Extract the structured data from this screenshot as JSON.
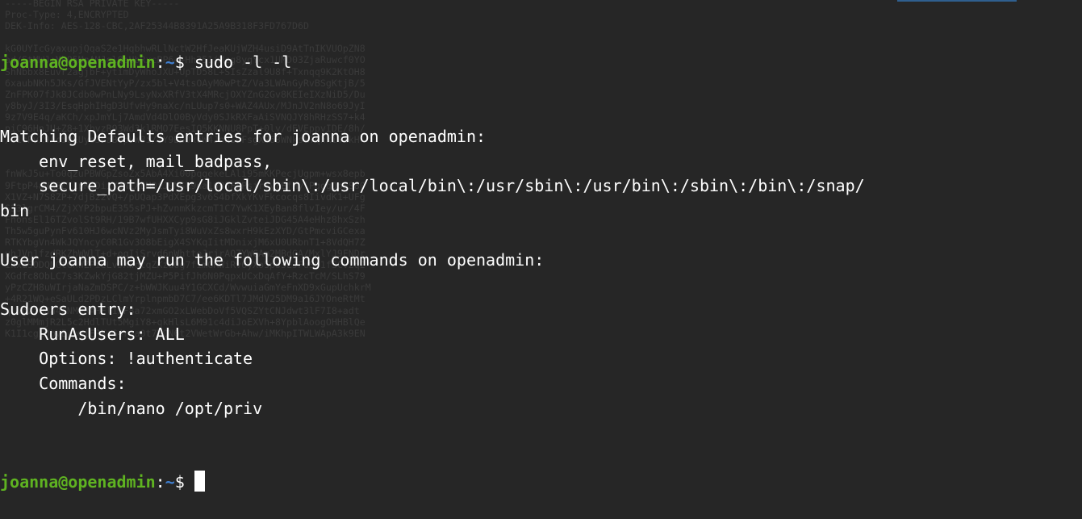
{
  "prompt": {
    "user_host": "joanna@openadmin",
    "separator": ":",
    "cwd": "~",
    "symbol": "$ "
  },
  "command": "sudo -l -l",
  "output": [
    "Matching Defaults entries for joanna on openadmin:",
    "    env_reset, mail_badpass,",
    "    secure_path=/usr/local/sbin\\:/usr/local/bin\\:/usr/sbin\\:/usr/bin\\:/sbin\\:/bin\\:/snap/",
    "bin",
    "",
    "User joanna may run the following commands on openadmin:",
    "",
    "Sudoers entry:",
    "    RunAsUsers: ALL",
    "    Options: !authenticate",
    "    Commands:",
    "        /bin/nano /opt/priv"
  ],
  "background_text": [
    "-----BEGIN RSA PRIVATE KEY-----",
    "Proc-Type: 4,ENCRYPTED",
    "DEK-Info: AES-128-CBC,2AF25344B8391A25A9B318F3FD767D6D",
    "",
    "kG0UYIcGyaxupjQqaS2e1HqbhwRLlNctW2HfJeaKUjWZH4usiD9AtTnIKVUOpZN8",
    "ad/StMWJ+MkQ5MnAMJglQeUbRxcBP6++Hh251jMcg8ygYcx1UMD03ZjaRuwcf0YO",
    "ShNbbx8Euvr2agjbF+ytimDyWhoJXU+UpTD58L+SIsZzal9U8f+Txnqq9K2KtOH8",
    "6xaubNKh5JKs/GfJVENtYyP/zx5bl+V4tsOAyM0wPtZ/Va3LWAnGyRvBSgKtjB/5",
    "ZnFPK07fJk8JCdb0wPnLNy9LsyNxXRfV3tX4MRcjOXYZnG2Gv8KEIeIXzNiD5/Du",
    "y8byJ/3I3/EsqHphIHgD3UfvHy9naXc/nLUup7s0+WAZ4AUx/MJnJV2nN8o69JyI",
    "9z7V9E4q/aKCh/xpJmYLj7AmdVd4DlO0ByVdy0SJkRXFaAiSVNQJY8hRHzSS7+k4",
    "piC96HnJU+Z8+1XbvzR93Wd3klRMO7EesIQ5KKNNU8PpT+0lv/dEVEppvIDE/8h/",
    "/U1cPvX9Aci0EUys3naB6pVW8i/IY9B6Dx6W4JnnSUFsgXR63WNkskTqhkiTikH",
    "",
    "",
    "fnWkJ5u+To0qzuPBWGpZsoZx5AbA4Xi00pqqekeLAli95mKKPecjUgpm+wsx8epb",
    "9FtpP4aNR8LYlpKSDiiYzNiXEMQiJ9MSk9na10B5FFPsjr+yYEfMylPgogDpES80",
    "X1VZ+N7S8ZP+7djB22vQ+/pUQap3PdXEpg3v6S4bfXkYKvFkcocqs8IivdK1+UFg",
    "S33lgrCM4/ZjXYP2bpuE355sPJ+hZvnmKkzcmT1C7YwK1XEyBan8flvIey/ur/4F",
    "FnonsEl16TZvolSt9RH/19B7wfUHXXCyp9sG8iJGklZvteiJDG45A4eHhz8hxSzh",
    "Th5w5guPynFv610HJ6wcNVz2MyJsmTyi8WuVxZs8wxrH9kEzXYD/GtPmcviGCexa",
    "RTKYbgVn4WkJQYncyC0R1Gv3O8bEigX4SYKqIitMDnixjM6xU0URbnT1+8VdQH7Z",
    "uhJVn1fzdRKZhWWlT+d+oqIiSrvd6nWhttoJrjrAQ7YWGAm2MBdGA/MxlYJ9FNDr",
    "1kxuSODQNGtGnWZPieLvDXwotqZKzdOg7fimGRWiRv6yXo5ps3EJFuSU1fSCv2q2",
    "XGdfc8ObLC7s3KZwkYjG82tjMZU+P5PifJh6N0PqpxUCxDqAfY+RzcTcM/SLhS79",
    "yPzCZH8uWIrjaNaZmDSPC/z+bWWJKuu4Y1GCXCd/WvwuiaGmYeFnXD9xGupUchkrM",
    "+4R21WQ+eSaULd2PDzLClmYrplnpmbD7C7/ee6KDTl7JMdV25DM9a16JYOneRtMt",
    "qlNgzj0Na4ZNMyRAHEl1SF8a72xmGO2xLWebDoVf5VQSZYtCNJdwt3lF7I8+adt",
    "z0glMMmjR2L5c2HdlTUt5MgiY8+qkHlsL6M91c4diJoEXVh+8YpblAoogOHHBlQe",
    "K1I1cgiDbVE/bmiERK+G4rqa0t7VQN6t2VWetWrGb+Ahw/iMKhpITWLWApA3k9EN"
  ]
}
